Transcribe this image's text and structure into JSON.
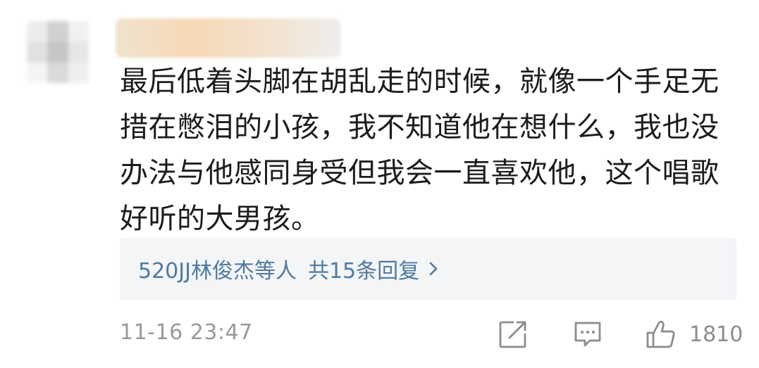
{
  "comment": {
    "text": "最后低着头脚在胡乱走的时候，就像一个手足无\n措在憋泪的小孩，我不知道他在想什么，我也没\n办法与他感同身受但我会一直喜欢他，这个唱歌\n好听的大男孩。"
  },
  "replies": {
    "users": "520JJ林俊杰等人",
    "count": "共15条回复"
  },
  "meta": {
    "timestamp": "11-16 23:47",
    "like_count": "1810"
  },
  "icons": {
    "share": "share-icon",
    "comment": "comment-icon",
    "like": "thumbs-up-icon",
    "chevron": "chevron-right-icon"
  },
  "colors": {
    "link": "#4e7aa1",
    "meta": "#9a9a9a",
    "reply_bg": "#f4f5f7"
  }
}
